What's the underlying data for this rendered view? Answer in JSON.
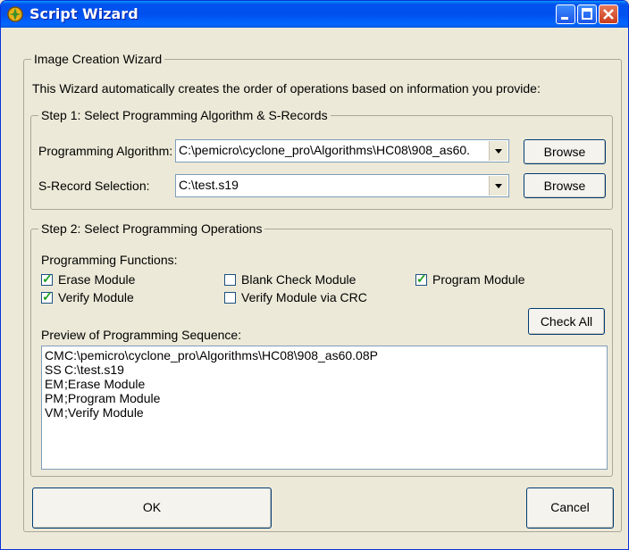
{
  "window": {
    "title": "Script Wizard"
  },
  "wizard": {
    "group_title": "Image Creation Wizard",
    "description": "This Wizard automatically creates the order of operations based on information you provide:"
  },
  "step1": {
    "title": "Step 1:  Select Programming Algorithm & S-Records",
    "algorithm_label": "Programming Algorithm:",
    "algorithm_value": "C:\\pemicro\\cyclone_pro\\Algorithms\\HC08\\908_as60.",
    "srecord_label": "S-Record Selection:",
    "srecord_value": "C:\\test.s19",
    "browse_label": "Browse"
  },
  "step2": {
    "title": "Step 2:  Select Programming Operations",
    "functions_label": "Programming Functions:",
    "checkboxes": [
      {
        "label": "Erase Module",
        "checked": true
      },
      {
        "label": "Blank Check Module",
        "checked": false
      },
      {
        "label": "Program Module",
        "checked": true
      },
      {
        "label": "Verify Module",
        "checked": true
      },
      {
        "label": "Verify Module via CRC",
        "checked": false
      }
    ],
    "check_all_label": "Check All",
    "preview_label": "Preview of Programming Sequence:",
    "preview_lines": [
      {
        "code": "CM",
        "text": "C:\\pemicro\\cyclone_pro\\Algorithms\\HC08\\908_as60.08P"
      },
      {
        "code": "SS",
        "text": "C:\\test.s19"
      },
      {
        "code": "EM",
        "text": ";Erase Module"
      },
      {
        "code": "PM",
        "text": ";Program Module"
      },
      {
        "code": "VM",
        "text": ";Verify Module"
      }
    ]
  },
  "footer": {
    "ok_label": "OK",
    "cancel_label": "Cancel"
  },
  "colors": {
    "title_bar": "#0053ee",
    "close_button": "#c93b1b",
    "dialog_bg": "#ece9d8"
  }
}
